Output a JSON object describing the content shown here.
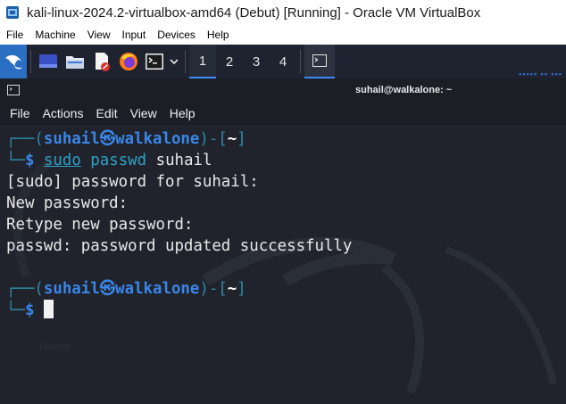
{
  "vbox": {
    "title": "kali-linux-2024.2-virtualbox-amd64 (Debut) [Running] - Oracle VM VirtualBox",
    "menu": [
      "File",
      "Machine",
      "View",
      "Input",
      "Devices",
      "Help"
    ]
  },
  "panel": {
    "launcher_icons": [
      "kali-menu-icon",
      "show-desktop-icon",
      "file-manager-icon",
      "text-editor-icon",
      "firefox-icon",
      "terminal-icon"
    ],
    "workspaces": [
      "1",
      "2",
      "3",
      "4"
    ],
    "active_workspace": "1"
  },
  "terminal": {
    "window_title": "suhail@walkalone: ~",
    "menu": [
      "File",
      "Actions",
      "Edit",
      "View",
      "Help"
    ],
    "prompt": {
      "user": "suhail",
      "host": "walkalone",
      "dir": "~",
      "symbol": "$"
    },
    "command": {
      "sudo": "sudo",
      "program": "passwd",
      "arg": "suhail"
    },
    "output": [
      "[sudo] password for suhail:",
      "New password:",
      "Retype new password:",
      "passwd: password updated successfully"
    ],
    "background_text": "Home"
  },
  "colors": {
    "accent": "#3a86e8",
    "terminal_bg": "#20232b",
    "panel_bg": "#1f2330"
  }
}
